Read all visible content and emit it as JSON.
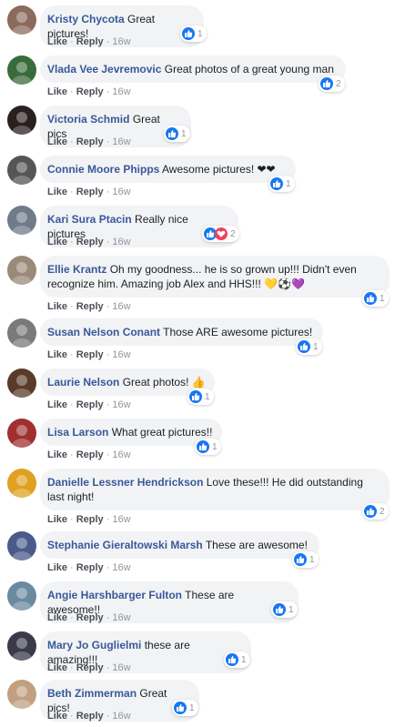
{
  "action_labels": {
    "like": "Like",
    "reply": "Reply",
    "dot": "·"
  },
  "colors": {
    "name": "#385898",
    "bubble": "#f2f3f5",
    "like_blue": "#1877f2",
    "love_red": "#f33e58"
  },
  "comments": [
    {
      "author": "Kristy Chycota",
      "text": "Great pictures!",
      "time": "16w",
      "reactions": {
        "types": [
          "like"
        ],
        "count": "1"
      },
      "avatar_color": "#8a6b5c"
    },
    {
      "author": "Vlada Vee Jevremovic",
      "text": "Great photos of a great young man",
      "time": "16w",
      "reactions": {
        "types": [
          "like"
        ],
        "count": "2"
      },
      "avatar_color": "#3a6b3a"
    },
    {
      "author": "Victoria Schmid",
      "text": "Great pics",
      "time": "16w",
      "reactions": {
        "types": [
          "like"
        ],
        "count": "1"
      },
      "avatar_color": "#2b2020"
    },
    {
      "author": "Connie Moore Phipps",
      "text": "Awesome pictures! ❤❤",
      "time": "16w",
      "reactions": {
        "types": [
          "like"
        ],
        "count": "1"
      },
      "avatar_color": "#555555"
    },
    {
      "author": "Kari Sura Ptacin",
      "text": "Really nice pictures",
      "time": "16w",
      "reactions": {
        "types": [
          "like",
          "love"
        ],
        "count": "2"
      },
      "avatar_color": "#6f7a8a"
    },
    {
      "author": "Ellie Krantz",
      "text": "Oh my goodness... he is so grown up!!! Didn't even recognize him. Amazing job Alex and HHS!!! 💛⚽💜",
      "time": "16w",
      "reactions": {
        "types": [
          "like"
        ],
        "count": "1"
      },
      "avatar_color": "#9a8a7a"
    },
    {
      "author": "Susan Nelson Conant",
      "text": "Those ARE awesome pictures!",
      "time": "16w",
      "reactions": {
        "types": [
          "like"
        ],
        "count": "1"
      },
      "avatar_color": "#7a7a7a"
    },
    {
      "author": "Laurie Nelson",
      "text": "Great photos! 👍",
      "time": "16w",
      "reactions": {
        "types": [
          "like"
        ],
        "count": "1"
      },
      "avatar_color": "#5a3a2a"
    },
    {
      "author": "Lisa Larson",
      "text": "What great pictures!!",
      "time": "16w",
      "reactions": {
        "types": [
          "like"
        ],
        "count": "1"
      },
      "avatar_color": "#a03030"
    },
    {
      "author": "Danielle Lessner Hendrickson",
      "text": "Love these!!! He did outstanding last night!",
      "time": "16w",
      "reactions": {
        "types": [
          "like"
        ],
        "count": "2"
      },
      "avatar_color": "#e0a020"
    },
    {
      "author": "Stephanie Gieraltowski Marsh",
      "text": "These are awesome!",
      "time": "16w",
      "reactions": {
        "types": [
          "like"
        ],
        "count": "1"
      },
      "avatar_color": "#4a5a8a"
    },
    {
      "author": "Angie Harshbarger Fulton",
      "text": "These are awesome!!",
      "time": "16w",
      "reactions": {
        "types": [
          "like"
        ],
        "count": "1"
      },
      "avatar_color": "#6a8aa0"
    },
    {
      "author": "Mary Jo Guglielmi",
      "text": "these are amazing!!!",
      "time": "16w",
      "reactions": {
        "types": [
          "like"
        ],
        "count": "1"
      },
      "avatar_color": "#3a3a4a"
    },
    {
      "author": "Beth Zimmerman",
      "text": "Great pics!",
      "time": "16w",
      "reactions": {
        "types": [
          "like"
        ],
        "count": "1"
      },
      "avatar_color": "#c0a080"
    }
  ]
}
